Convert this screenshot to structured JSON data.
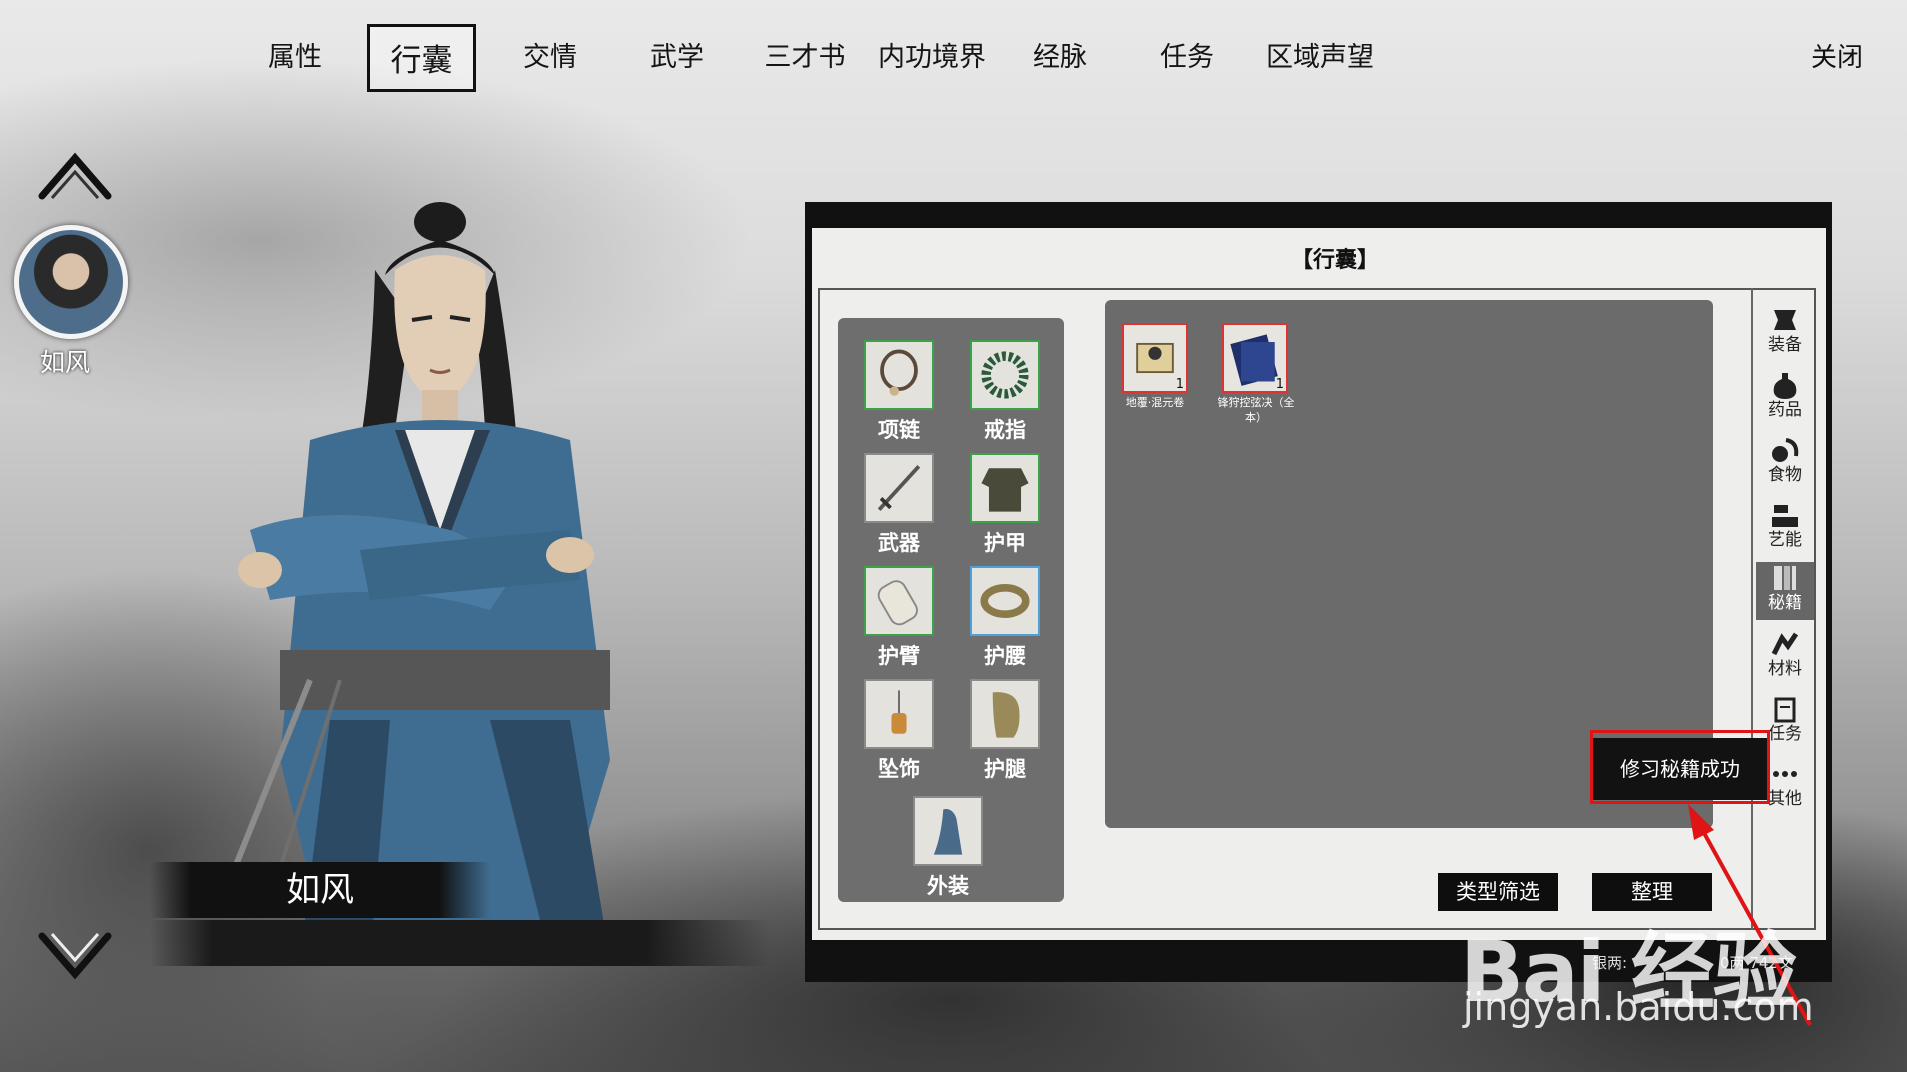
{
  "nav": {
    "tabs": [
      {
        "label": "属性"
      },
      {
        "label": "行囊"
      },
      {
        "label": "交情"
      },
      {
        "label": "武学"
      },
      {
        "label": "三才书"
      },
      {
        "label": "内功境界"
      },
      {
        "label": "经脉"
      },
      {
        "label": "任务"
      },
      {
        "label": "区域声望"
      }
    ],
    "active_tab": "行囊",
    "close_label": "关闭"
  },
  "character": {
    "avatar_name": "如风",
    "banner_name": "如风"
  },
  "panel": {
    "title": "【行囊】",
    "equipment_slots": [
      {
        "label": "项链",
        "icon": "necklace-icon"
      },
      {
        "label": "戒指",
        "icon": "ring-icon"
      },
      {
        "label": "武器",
        "icon": "sword-icon"
      },
      {
        "label": "护甲",
        "icon": "armor-icon"
      },
      {
        "label": "护臂",
        "icon": "bracer-icon"
      },
      {
        "label": "护腰",
        "icon": "belt-icon"
      },
      {
        "label": "坠饰",
        "icon": "pendant-icon"
      },
      {
        "label": "护腿",
        "icon": "greaves-icon"
      },
      {
        "label": "外装",
        "icon": "outfit-icon"
      }
    ],
    "items": [
      {
        "name": "地覆·混元卷",
        "count": "1",
        "icon": "scroll-icon"
      },
      {
        "name": "锋狩控弦决（全本）",
        "count": "1",
        "icon": "manual-book-icon"
      }
    ],
    "categories": [
      {
        "label": "装备",
        "icon": "equipment-icon"
      },
      {
        "label": "药品",
        "icon": "medicine-icon"
      },
      {
        "label": "食物",
        "icon": "food-icon"
      },
      {
        "label": "艺能",
        "icon": "craft-icon"
      },
      {
        "label": "秘籍",
        "icon": "secret-book-icon"
      },
      {
        "label": "材料",
        "icon": "materials-icon"
      },
      {
        "label": "任务",
        "icon": "quest-icon"
      },
      {
        "label": "其他",
        "icon": "other-icon"
      }
    ],
    "active_category": "秘籍",
    "filter_button": "类型筛选",
    "sort_button": "整理",
    "money_label": "银两:",
    "money_value": "0两 742文"
  },
  "toast": {
    "text": "修习秘籍成功"
  },
  "watermark": {
    "brand": "Bai 经验",
    "url": "jingyan.baidu.com"
  },
  "colors": {
    "highlight": "#e01414",
    "ink": "#111111",
    "slot_green": "#3ba24a",
    "slot_blue": "#4fa0d8",
    "item_red": "#dd3333"
  }
}
